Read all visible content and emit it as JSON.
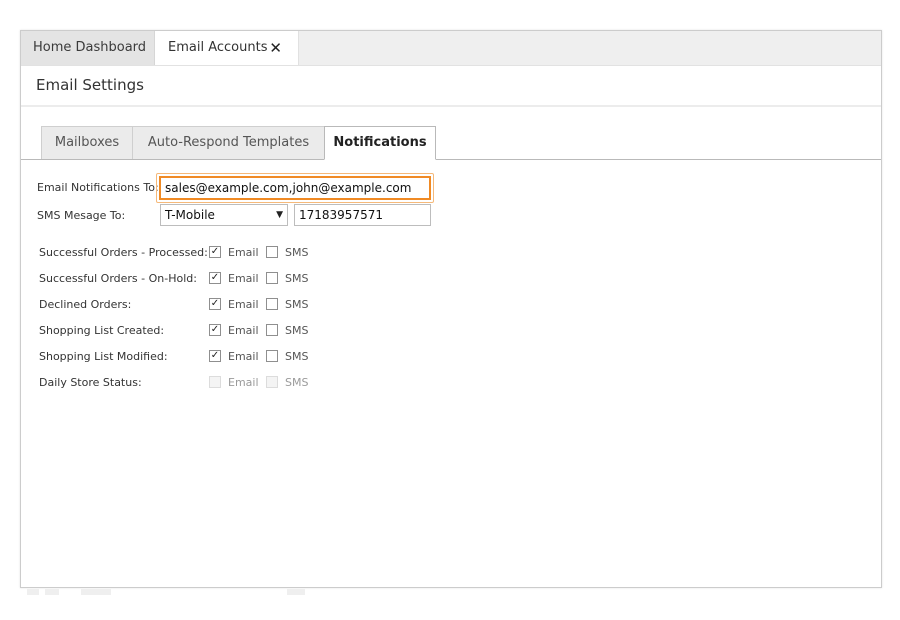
{
  "tabs": {
    "home": "Home Dashboard",
    "email_accounts": "Email Accounts",
    "close_glyph": "✕"
  },
  "page": {
    "title": "Email Settings"
  },
  "subtabs": {
    "mailboxes": "Mailboxes",
    "auto_respond": "Auto-Respond Templates",
    "notifications": "Notifications"
  },
  "form": {
    "email_label": "Email Notifications To:",
    "email_value": "sales@example.com,john@example.com",
    "sms_label": "SMS Mesage To:",
    "carrier": "T-Mobile",
    "phone": "17183957571"
  },
  "rows": [
    {
      "label": "Successful Orders - Processed:",
      "email_checked": true,
      "sms_checked": false,
      "disabled": false
    },
    {
      "label": "Successful Orders - On-Hold:",
      "email_checked": true,
      "sms_checked": false,
      "disabled": false
    },
    {
      "label": "Declined Orders:",
      "email_checked": true,
      "sms_checked": false,
      "disabled": false
    },
    {
      "label": "Shopping List Created:",
      "email_checked": true,
      "sms_checked": false,
      "disabled": false
    },
    {
      "label": "Shopping List Modified:",
      "email_checked": true,
      "sms_checked": false,
      "disabled": false
    },
    {
      "label": "Daily Store Status:",
      "email_checked": false,
      "sms_checked": false,
      "disabled": true
    }
  ],
  "checkbox_labels": {
    "email": "Email",
    "sms": "SMS"
  },
  "colors": {
    "focus_border": "#f08a24"
  }
}
